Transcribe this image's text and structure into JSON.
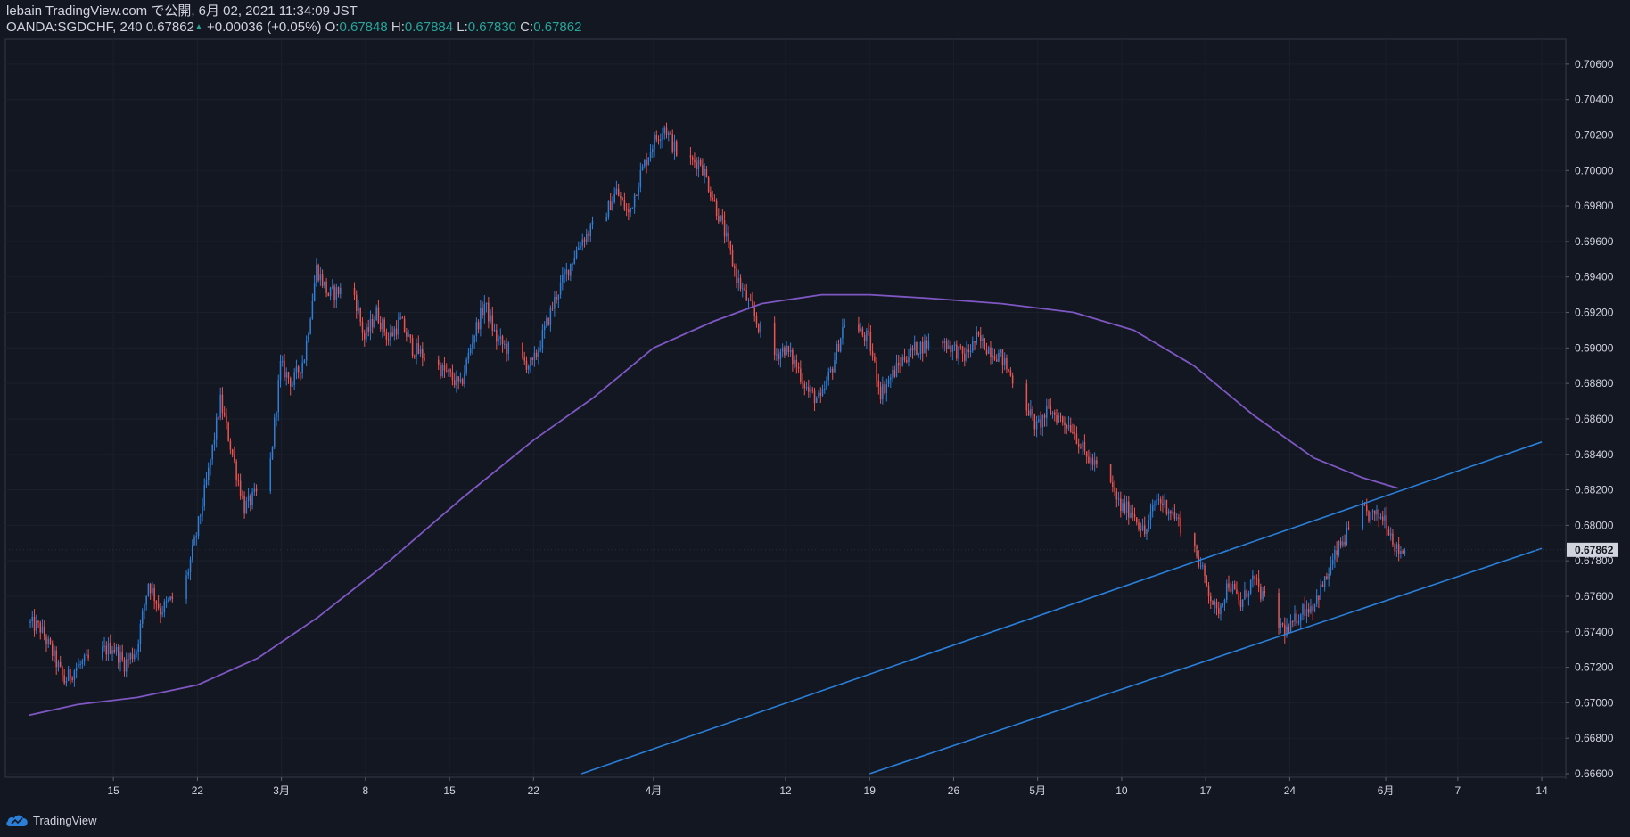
{
  "header": {
    "line1": "lebain TradingView.com で公開, 6月 02, 2021 11:34:09 JST",
    "symbol": "OANDA:SGDCHF, 240 0.67862",
    "change": "+0.00036 (+0.05%)",
    "o_label": "O:",
    "o_value": "0.67848",
    "h_label": "H:",
    "h_value": "0.67884",
    "l_label": "L:",
    "l_value": "0.67830",
    "c_label": "C:",
    "c_value": "0.67862"
  },
  "footer": {
    "brand": "TradingView"
  },
  "colors": {
    "background": "#131722",
    "up_candle": "#2f7fd8",
    "down_candle": "#ef5350",
    "moving_average": "#7e57c2",
    "trend_channel": "#2a7fd9",
    "axis_text": "#d1d4dc",
    "last_price_label_bg": "#d1d4dc"
  },
  "chart_data": {
    "type": "candlestick",
    "symbol": "OANDA:SGDCHF",
    "timeframe": "240",
    "last_price": "0.67862",
    "ylim": [
      0.6658,
      0.7074
    ],
    "y_ticks": [
      "0.70600",
      "0.70400",
      "0.70200",
      "0.70000",
      "0.69800",
      "0.69600",
      "0.69400",
      "0.69200",
      "0.69000",
      "0.68800",
      "0.68600",
      "0.68400",
      "0.68200",
      "0.68000",
      "0.67800",
      "0.67600",
      "0.67400",
      "0.67200",
      "0.67000",
      "0.66800",
      "0.66600"
    ],
    "x_ticks": [
      {
        "label": "15",
        "date": "2021-02-15"
      },
      {
        "label": "22",
        "date": "2021-02-22"
      },
      {
        "label": "3月",
        "date": "2021-03-01"
      },
      {
        "label": "8",
        "date": "2021-03-08"
      },
      {
        "label": "15",
        "date": "2021-03-15"
      },
      {
        "label": "22",
        "date": "2021-03-22"
      },
      {
        "label": "4月",
        "date": "2021-04-01"
      },
      {
        "label": "12",
        "date": "2021-04-12"
      },
      {
        "label": "19",
        "date": "2021-04-19"
      },
      {
        "label": "26",
        "date": "2021-04-26"
      },
      {
        "label": "5月",
        "date": "2021-05-03"
      },
      {
        "label": "10",
        "date": "2021-05-10"
      },
      {
        "label": "17",
        "date": "2021-05-17"
      },
      {
        "label": "24",
        "date": "2021-05-24"
      },
      {
        "label": "6月",
        "date": "2021-06-01"
      },
      {
        "label": "7",
        "date": "2021-06-07"
      },
      {
        "label": "14",
        "date": "2021-06-14"
      }
    ],
    "price_path": [
      [
        "2021-02-08",
        0.6745
      ],
      [
        "2021-02-09",
        0.6742
      ],
      [
        "2021-02-10",
        0.6728
      ],
      [
        "2021-02-11",
        0.6712
      ],
      [
        "2021-02-12",
        0.672
      ],
      [
        "2021-02-14",
        0.6728
      ],
      [
        "2021-02-15",
        0.6732
      ],
      [
        "2021-02-16",
        0.6722
      ],
      [
        "2021-02-17",
        0.673
      ],
      [
        "2021-02-18",
        0.6768
      ],
      [
        "2021-02-19",
        0.6752
      ],
      [
        "2021-02-21",
        0.6765
      ],
      [
        "2021-02-22",
        0.6795
      ],
      [
        "2021-02-23",
        0.683
      ],
      [
        "2021-02-24",
        0.687
      ],
      [
        "2021-02-25",
        0.684
      ],
      [
        "2021-02-26",
        0.681
      ],
      [
        "2021-02-28",
        0.6825
      ],
      [
        "2021-03-01",
        0.689
      ],
      [
        "2021-03-02",
        0.688
      ],
      [
        "2021-03-03",
        0.6895
      ],
      [
        "2021-03-04",
        0.6945
      ],
      [
        "2021-03-05",
        0.693
      ],
      [
        "2021-03-07",
        0.6935
      ],
      [
        "2021-03-08",
        0.6905
      ],
      [
        "2021-03-09",
        0.692
      ],
      [
        "2021-03-10",
        0.6905
      ],
      [
        "2021-03-11",
        0.6915
      ],
      [
        "2021-03-12",
        0.69
      ],
      [
        "2021-03-14",
        0.689
      ],
      [
        "2021-03-15",
        0.6885
      ],
      [
        "2021-03-16",
        0.6878
      ],
      [
        "2021-03-17",
        0.6905
      ],
      [
        "2021-03-18",
        0.6925
      ],
      [
        "2021-03-19",
        0.6905
      ],
      [
        "2021-03-21",
        0.6893
      ],
      [
        "2021-03-22",
        0.689
      ],
      [
        "2021-03-23",
        0.691
      ],
      [
        "2021-03-24",
        0.693
      ],
      [
        "2021-03-25",
        0.6945
      ],
      [
        "2021-03-26",
        0.696
      ],
      [
        "2021-03-28",
        0.6975
      ],
      [
        "2021-03-29",
        0.6988
      ],
      [
        "2021-03-30",
        0.6975
      ],
      [
        "2021-03-31",
        0.6998
      ],
      [
        "2021-04-01",
        0.7015
      ],
      [
        "2021-04-02",
        0.7025
      ],
      [
        "2021-04-03",
        0.701
      ],
      [
        "2021-04-04",
        0.7005
      ],
      [
        "2021-04-05",
        0.7005
      ],
      [
        "2021-04-06",
        0.6985
      ],
      [
        "2021-04-07",
        0.6965
      ],
      [
        "2021-04-08",
        0.694
      ],
      [
        "2021-04-09",
        0.6925
      ],
      [
        "2021-04-11",
        0.6895
      ],
      [
        "2021-04-12",
        0.69
      ],
      [
        "2021-04-13",
        0.689
      ],
      [
        "2021-04-14",
        0.6875
      ],
      [
        "2021-04-15",
        0.687
      ],
      [
        "2021-04-16",
        0.689
      ],
      [
        "2021-04-17",
        0.6915
      ],
      [
        "2021-04-19",
        0.6905
      ],
      [
        "2021-04-20",
        0.6875
      ],
      [
        "2021-04-21",
        0.6885
      ],
      [
        "2021-04-22",
        0.6895
      ],
      [
        "2021-04-23",
        0.69
      ],
      [
        "2021-04-25",
        0.6905
      ],
      [
        "2021-04-26",
        0.69
      ],
      [
        "2021-04-27",
        0.6895
      ],
      [
        "2021-04-28",
        0.6905
      ],
      [
        "2021-04-29",
        0.69
      ],
      [
        "2021-04-30",
        0.6895
      ],
      [
        "2021-05-02",
        0.687
      ],
      [
        "2021-05-03",
        0.6855
      ],
      [
        "2021-05-04",
        0.6865
      ],
      [
        "2021-05-05",
        0.686
      ],
      [
        "2021-05-06",
        0.6855
      ],
      [
        "2021-05-07",
        0.684
      ],
      [
        "2021-05-09",
        0.6825
      ],
      [
        "2021-05-10",
        0.681
      ],
      [
        "2021-05-11",
        0.6808
      ],
      [
        "2021-05-12",
        0.6795
      ],
      [
        "2021-05-13",
        0.6815
      ],
      [
        "2021-05-14",
        0.681
      ],
      [
        "2021-05-16",
        0.679
      ],
      [
        "2021-05-17",
        0.677
      ],
      [
        "2021-05-18",
        0.675
      ],
      [
        "2021-05-19",
        0.6768
      ],
      [
        "2021-05-20",
        0.6755
      ],
      [
        "2021-05-21",
        0.677
      ],
      [
        "2021-05-23",
        0.6745
      ],
      [
        "2021-05-24",
        0.674
      ],
      [
        "2021-05-25",
        0.6752
      ],
      [
        "2021-05-26",
        0.6755
      ],
      [
        "2021-05-27",
        0.6768
      ],
      [
        "2021-05-28",
        0.6785
      ],
      [
        "2021-05-30",
        0.6808
      ],
      [
        "2021-05-31",
        0.6805
      ],
      [
        "2021-06-01",
        0.6805
      ],
      [
        "2021-06-02",
        0.6786
      ]
    ],
    "moving_average": {
      "color": "#7e57c2",
      "points": [
        [
          "2021-02-08",
          0.6693
        ],
        [
          "2021-02-12",
          0.6699
        ],
        [
          "2021-02-17",
          0.6703
        ],
        [
          "2021-02-22",
          0.671
        ],
        [
          "2021-02-27",
          0.6725
        ],
        [
          "2021-03-04",
          0.6748
        ],
        [
          "2021-03-10",
          0.678
        ],
        [
          "2021-03-16",
          0.6815
        ],
        [
          "2021-03-22",
          0.6848
        ],
        [
          "2021-03-27",
          0.6872
        ],
        [
          "2021-04-01",
          0.69
        ],
        [
          "2021-04-06",
          0.6915
        ],
        [
          "2021-04-10",
          0.6925
        ],
        [
          "2021-04-15",
          0.693
        ],
        [
          "2021-04-19",
          0.693
        ],
        [
          "2021-04-24",
          0.6928
        ],
        [
          "2021-04-30",
          0.6925
        ],
        [
          "2021-05-06",
          0.692
        ],
        [
          "2021-05-11",
          0.691
        ],
        [
          "2021-05-16",
          0.689
        ],
        [
          "2021-05-21",
          0.6862
        ],
        [
          "2021-05-26",
          0.6838
        ],
        [
          "2021-05-30",
          0.6827
        ],
        [
          "2021-06-02",
          0.6821
        ]
      ]
    },
    "trend_lines": [
      {
        "name": "channel-upper",
        "color": "#2a7fd9",
        "points": [
          [
            "2021-03-26",
            0.666
          ],
          [
            "2021-06-14",
            0.6847
          ]
        ]
      },
      {
        "name": "channel-lower",
        "color": "#2a7fd9",
        "points": [
          [
            "2021-04-19",
            0.666
          ],
          [
            "2021-06-14",
            0.6787
          ]
        ]
      }
    ]
  }
}
